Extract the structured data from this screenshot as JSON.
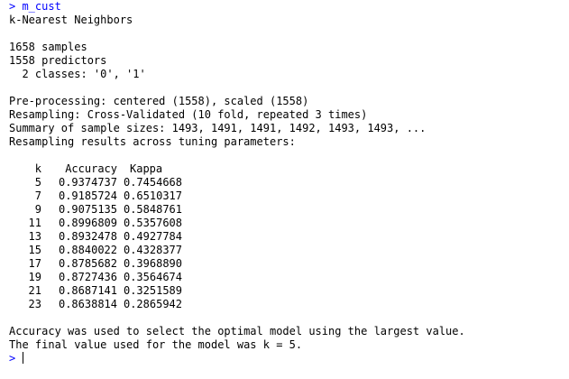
{
  "console": {
    "command_prompt": "> ",
    "command": "m_cust",
    "model_title": "k-Nearest Neighbors",
    "samples": "1658 samples",
    "predictors": "1558 predictors",
    "classes": "  2 classes: '0', '1'",
    "preprocessing": "Pre-processing: centered (1558), scaled (1558)",
    "resampling": "Resampling: Cross-Validated (10 fold, repeated 3 times)",
    "sample_sizes": "Summary of sample sizes: 1493, 1491, 1491, 1492, 1493, 1493, ...",
    "results_header": "Resampling results across tuning parameters:",
    "table": {
      "headers": [
        "k",
        "Accuracy",
        "Kappa"
      ],
      "rows": [
        {
          "k": "5",
          "accuracy": "0.9374737",
          "kappa": "0.7454668"
        },
        {
          "k": "7",
          "accuracy": "0.9185724",
          "kappa": "0.6510317"
        },
        {
          "k": "9",
          "accuracy": "0.9075135",
          "kappa": "0.5848761"
        },
        {
          "k": "11",
          "accuracy": "0.8996809",
          "kappa": "0.5357608"
        },
        {
          "k": "13",
          "accuracy": "0.8932478",
          "kappa": "0.4927784"
        },
        {
          "k": "15",
          "accuracy": "0.8840022",
          "kappa": "0.4328377"
        },
        {
          "k": "17",
          "accuracy": "0.8785682",
          "kappa": "0.3968890"
        },
        {
          "k": "19",
          "accuracy": "0.8727436",
          "kappa": "0.3564674"
        },
        {
          "k": "21",
          "accuracy": "0.8687141",
          "kappa": "0.3251589"
        },
        {
          "k": "23",
          "accuracy": "0.8638814",
          "kappa": "0.2865942"
        }
      ]
    },
    "summary_line1": "Accuracy was used to select the optimal model using the largest value.",
    "summary_line2": "The final value used for the model was k = 5.",
    "final_prompt": "> ",
    "colors": {
      "command": "#0000ff",
      "output": "#000000",
      "background": "#ffffff"
    }
  }
}
